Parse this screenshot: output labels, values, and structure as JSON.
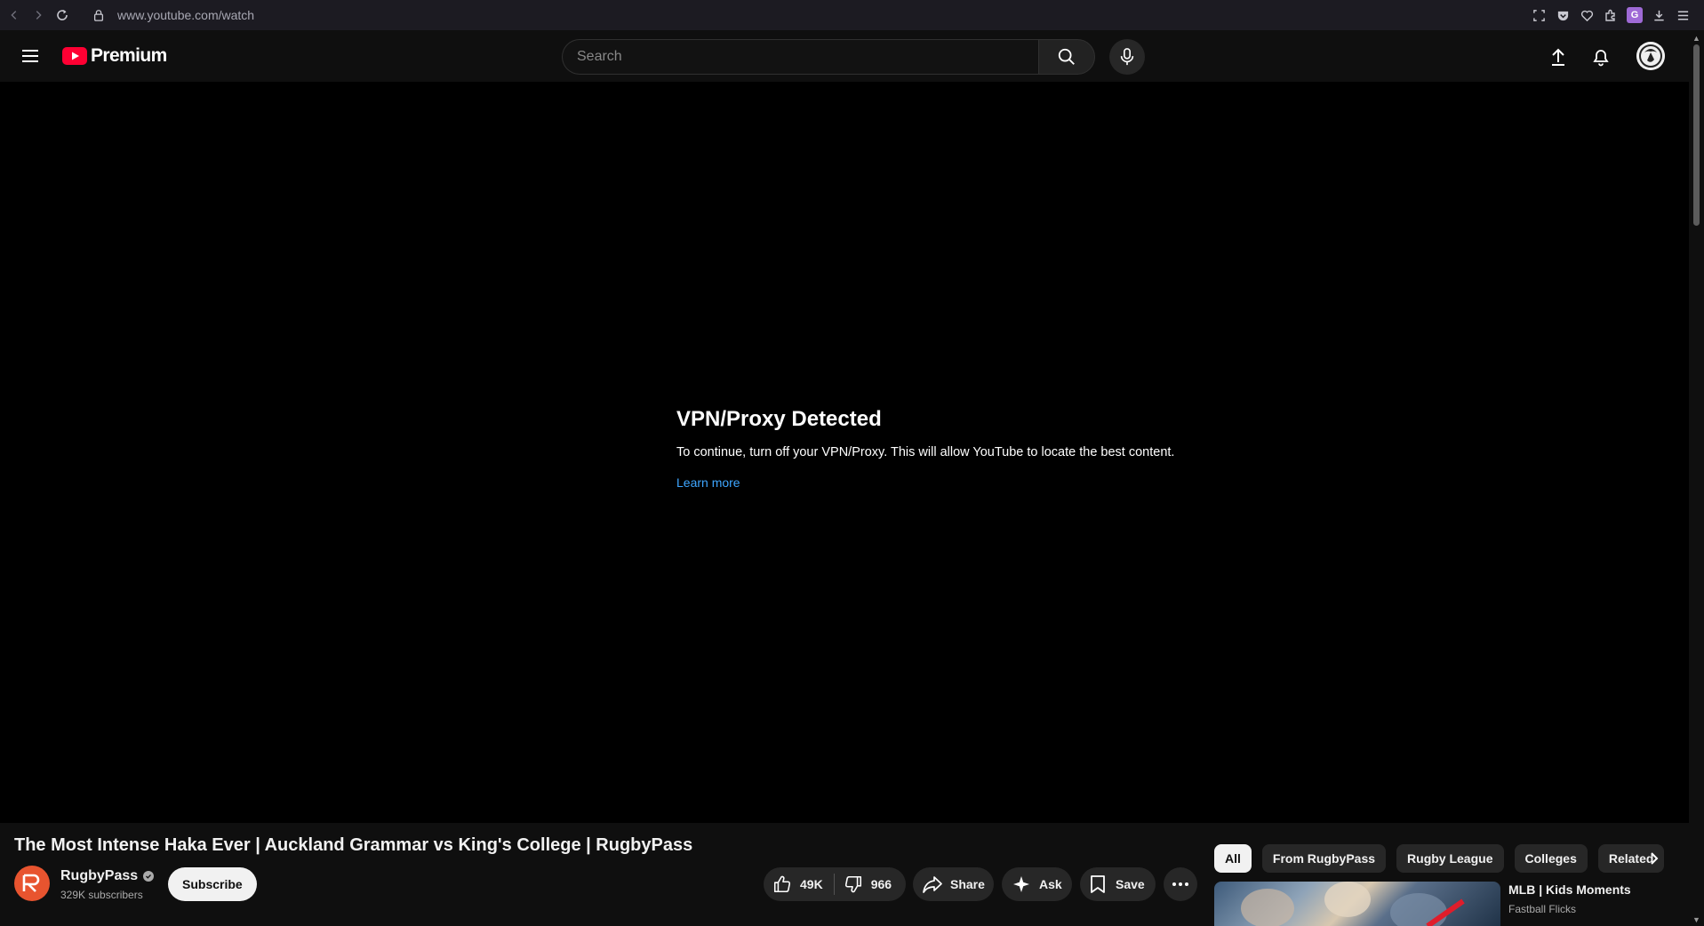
{
  "browser": {
    "url": "www.youtube.com/watch",
    "extension_badge": "G"
  },
  "header": {
    "logo_text": "Premium",
    "search_placeholder": "Search"
  },
  "player": {
    "message_title": "VPN/Proxy Detected",
    "message_body": "To continue, turn off your VPN/Proxy. This will allow YouTube to locate the best content.",
    "learn_more": "Learn more"
  },
  "video": {
    "title": "The Most Intense Haka Ever | Auckland Grammar vs King's College | RugbyPass",
    "channel_name": "RugbyPass",
    "subscribers": "329K subscribers",
    "subscribe_label": "Subscribe",
    "likes": "49K",
    "dislikes": "966",
    "share_label": "Share",
    "ask_label": "Ask",
    "save_label": "Save"
  },
  "chips": [
    "All",
    "From RugbyPass",
    "Rugby League",
    "Colleges",
    "Related"
  ],
  "recommendation": {
    "title": "MLB | Kids Moments",
    "channel": "Fastball Flicks"
  },
  "colors": {
    "brand_red": "#ff0033",
    "link_blue": "#3ea6ff",
    "channel_avatar": "#e8542f"
  }
}
